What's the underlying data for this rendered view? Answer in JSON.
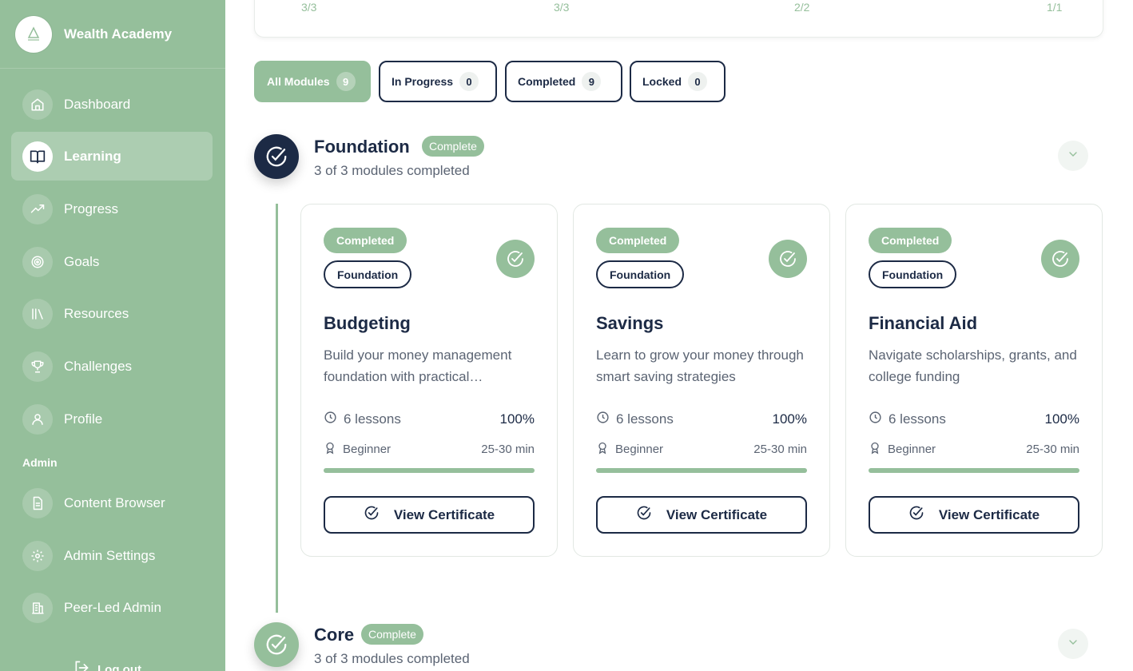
{
  "brand": {
    "name": "Wealth Academy"
  },
  "sidebar": {
    "items": [
      {
        "label": "Dashboard",
        "icon": "home-icon"
      },
      {
        "label": "Learning",
        "icon": "book-icon",
        "active": true
      },
      {
        "label": "Progress",
        "icon": "trending-up-icon"
      },
      {
        "label": "Goals",
        "icon": "target-icon"
      },
      {
        "label": "Resources",
        "icon": "library-icon"
      },
      {
        "label": "Challenges",
        "icon": "trophy-icon"
      },
      {
        "label": "Profile",
        "icon": "user-icon"
      }
    ],
    "admin_heading": "Admin",
    "admin_items": [
      {
        "label": "Content Browser",
        "icon": "document-icon"
      },
      {
        "label": "Admin Settings",
        "icon": "gear-icon"
      },
      {
        "label": "Peer-Led Admin",
        "icon": "building-icon"
      }
    ],
    "logout": "Log out"
  },
  "stats": {
    "values": [
      "3/3",
      "3/3",
      "2/2",
      "1/1"
    ]
  },
  "filters": [
    {
      "label": "All Modules",
      "count": "9",
      "active": true
    },
    {
      "label": "In Progress",
      "count": "0"
    },
    {
      "label": "Completed",
      "count": "9"
    },
    {
      "label": "Locked",
      "count": "0"
    }
  ],
  "sections": [
    {
      "title": "Foundation",
      "badge": "Complete",
      "subtitle": "3 of 3 modules completed",
      "modules": [
        {
          "status": "Completed",
          "tier": "Foundation",
          "title": "Budgeting",
          "description": "Build your money management foundation with practical…",
          "lessons": "6 lessons",
          "percent": "100%",
          "level": "Beginner",
          "duration": "25-30 min",
          "progress": 1.0,
          "action": "View Certificate"
        },
        {
          "status": "Completed",
          "tier": "Foundation",
          "title": "Savings",
          "description": "Learn to grow your money through smart saving strategies",
          "lessons": "6 lessons",
          "percent": "100%",
          "level": "Beginner",
          "duration": "25-30 min",
          "progress": 1.0,
          "action": "View Certificate"
        },
        {
          "status": "Completed",
          "tier": "Foundation",
          "title": "Financial Aid",
          "description": "Navigate scholarships, grants, and college funding",
          "lessons": "6 lessons",
          "percent": "100%",
          "level": "Beginner",
          "duration": "25-30 min",
          "progress": 1.0,
          "action": "View Certificate"
        }
      ]
    },
    {
      "title": "Core",
      "badge": "Complete",
      "subtitle": "3 of 3 modules completed"
    }
  ],
  "colors": {
    "accent": "#95bf9b",
    "navy": "#1c2a45",
    "muted": "#5b6473"
  }
}
